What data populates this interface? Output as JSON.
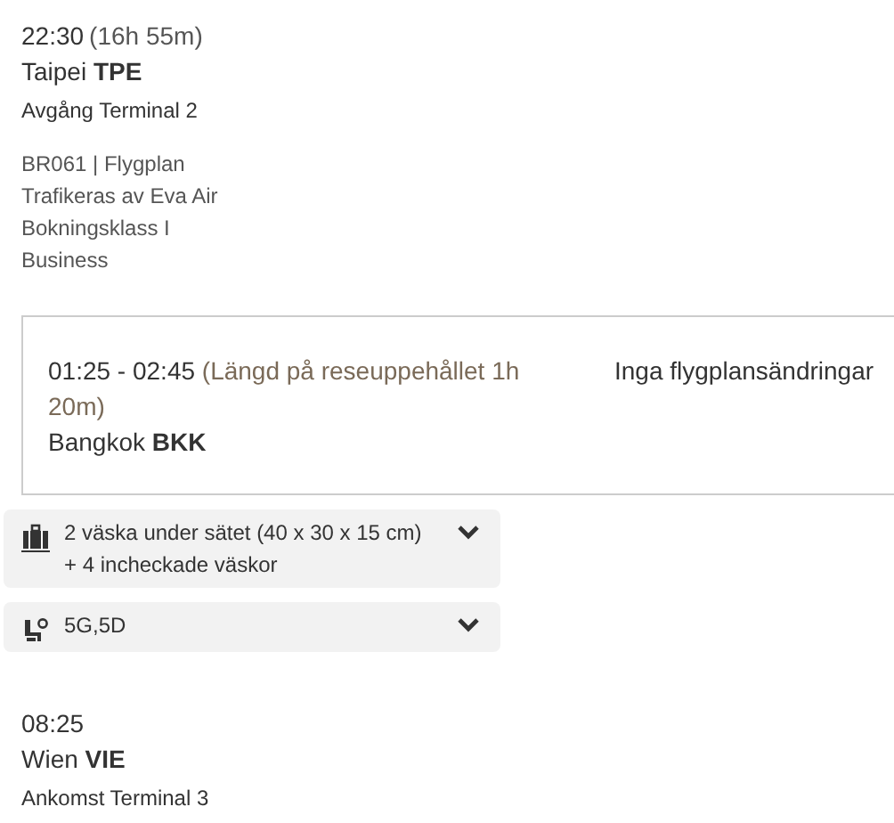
{
  "departure": {
    "time": "22:30",
    "duration": "(16h 55m)",
    "city": "Taipei **TPE**",
    "terminal": "Avgång Terminal 2"
  },
  "flight_details": [
    "BR061 | Flygplan",
    "Trafikeras av Eva Air",
    "Bokningsklass I",
    "Business"
  ],
  "stopover": {
    "times": "01:25 - 02:45",
    "layover": "(Längd på reseuppehållet 1h 20m)",
    "city": "Bangkok  **BKK**",
    "note": "Inga flygplansändringar"
  },
  "panels": [
    {
      "kind": "baggage",
      "lines": [
        "2 väska under sätet (40 x 30 x 15 cm)",
        "+ 4 incheckade väskor"
      ],
      "expanded": false
    },
    {
      "kind": "seat",
      "lines": [
        "5G,5D"
      ],
      "expanded": false
    }
  ],
  "arrival": {
    "time": "08:25",
    "city": "Wien **VIE**",
    "terminal": "Ankomst Terminal 3"
  }
}
